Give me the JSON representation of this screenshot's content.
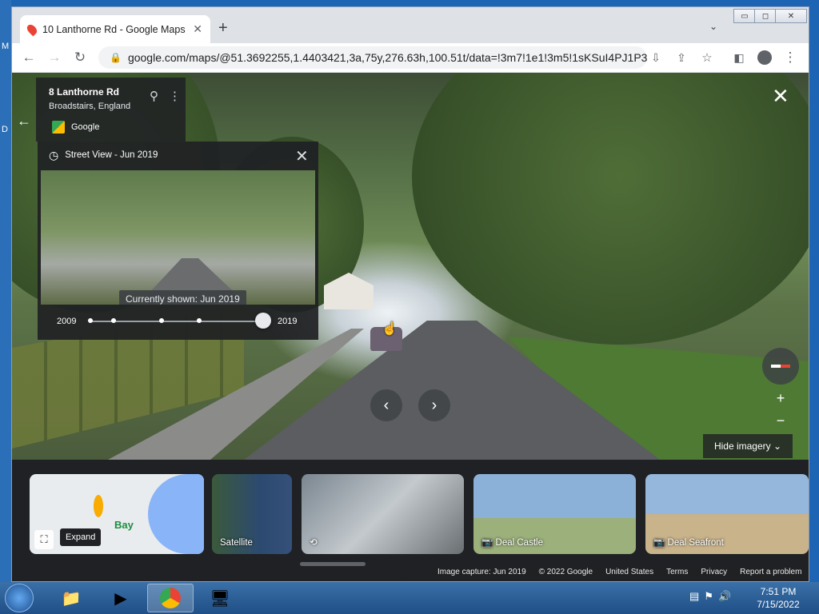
{
  "desktop": {
    "edge_letters": [
      "M",
      "D"
    ]
  },
  "browser": {
    "tab_title": "10 Lanthorne Rd - Google Maps",
    "tab_close": "✕",
    "new_tab": "+",
    "tab_search": "⌄",
    "window_controls": {
      "minimize": "▭",
      "maximize": "◻",
      "close": "✕"
    },
    "url": "google.com/maps/@51.3692255,1.4403421,3a,75y,276.63h,100.51t/data=!3m7!1e1!3m5!1sKSuI4PJ1P3..."
  },
  "place_card": {
    "title": "8 Lanthorne Rd",
    "subtitle": "Broadstairs, England",
    "source": "Google"
  },
  "time_machine": {
    "header": "Street View - Jun 2019",
    "currently_shown": "Currently shown: Jun 2019",
    "year_start": "2009",
    "year_end": "2019",
    "slider_fraction": 1.0
  },
  "controls": {
    "hide_imagery": "Hide imagery ⌄",
    "zoom_in": "+",
    "zoom_out": "−",
    "prev": "‹",
    "next": "›"
  },
  "cards": {
    "map_label": "Bay",
    "expand": "Expand",
    "satellite": "Satellite",
    "deal_castle": "Deal Castle",
    "deal_seafront": "Deal Seafront"
  },
  "footer": {
    "capture": "Image capture: Jun 2019",
    "copyright": "© 2022 Google",
    "region": "United States",
    "terms": "Terms",
    "privacy": "Privacy",
    "report": "Report a problem"
  },
  "taskbar": {
    "time": "7:51 PM",
    "date": "7/15/2022"
  },
  "colors": {
    "accent": "#1a73e8",
    "panel": "#202124"
  }
}
